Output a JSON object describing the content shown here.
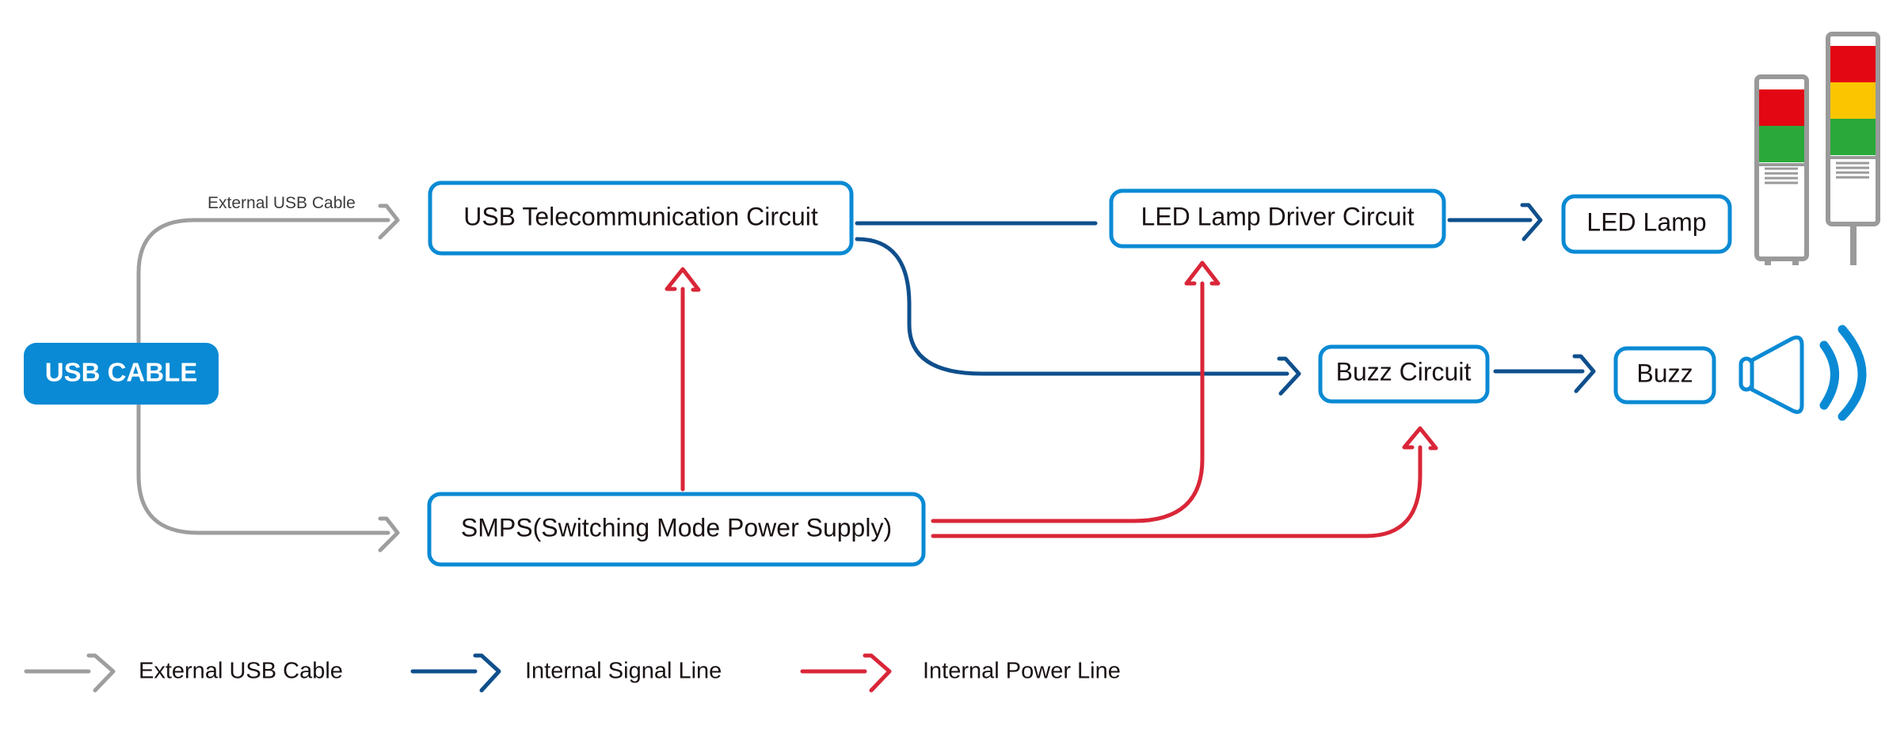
{
  "diagram": {
    "source": {
      "label": "USB CABLE"
    },
    "nodes": {
      "usb_telecom": {
        "label": "USB Telecommunication Circuit"
      },
      "smps": {
        "label": "SMPS(Switching Mode Power Supply)"
      },
      "led_driver": {
        "label": "LED Lamp Driver Circuit"
      },
      "led_lamp": {
        "label": "LED Lamp"
      },
      "buzz_circuit": {
        "label": "Buzz Circuit"
      },
      "buzz": {
        "label": "Buzz"
      }
    },
    "edge_labels": {
      "external_usb_cable": "External USB Cable"
    },
    "connections": [
      {
        "from": "USB CABLE",
        "to": "USB Telecommunication Circuit",
        "type": "external"
      },
      {
        "from": "USB CABLE",
        "to": "SMPS(Switching Mode Power Supply)",
        "type": "external"
      },
      {
        "from": "USB Telecommunication Circuit",
        "to": "LED Lamp Driver Circuit",
        "type": "signal"
      },
      {
        "from": "USB Telecommunication Circuit",
        "to": "Buzz Circuit",
        "type": "signal"
      },
      {
        "from": "LED Lamp Driver Circuit",
        "to": "LED Lamp",
        "type": "signal"
      },
      {
        "from": "Buzz Circuit",
        "to": "Buzz",
        "type": "signal"
      },
      {
        "from": "SMPS(Switching Mode Power Supply)",
        "to": "USB Telecommunication Circuit",
        "type": "power"
      },
      {
        "from": "SMPS(Switching Mode Power Supply)",
        "to": "LED Lamp Driver Circuit",
        "type": "power"
      },
      {
        "from": "SMPS(Switching Mode Power Supply)",
        "to": "Buzz Circuit",
        "type": "power"
      }
    ],
    "icons": {
      "signal_tower_two_tier": {
        "name": "signal-tower-2-tier-icon",
        "tiers": [
          "red",
          "green"
        ]
      },
      "signal_tower_three_tier": {
        "name": "signal-tower-3-tier-icon",
        "tiers": [
          "red",
          "yellow",
          "green"
        ]
      },
      "speaker": {
        "name": "speaker-sound-icon"
      }
    }
  },
  "legend": {
    "items": [
      {
        "label": "External USB Cable",
        "type": "external"
      },
      {
        "label": "Internal Signal Line",
        "type": "signal"
      },
      {
        "label": "Internal Power Line",
        "type": "power"
      }
    ]
  },
  "colors": {
    "primary_blue": "#0a8ad4",
    "external_gray": "#9e9e9e",
    "signal_blue": "#0f4f8c",
    "power_red": "#d92638",
    "lamp_red": "#e30613",
    "lamp_yellow": "#fbc500",
    "lamp_green": "#2aa93a"
  }
}
